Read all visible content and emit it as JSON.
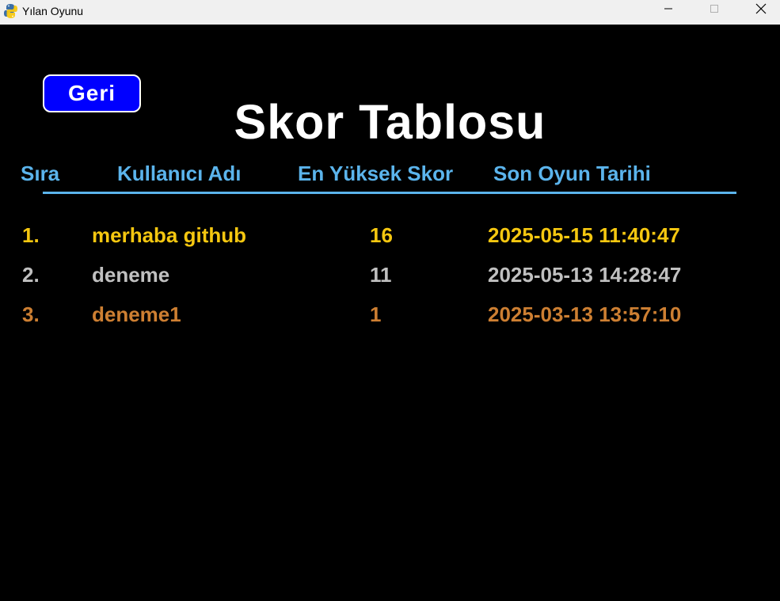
{
  "window": {
    "title": "Yılan Oyunu",
    "app_icon": "python-icon"
  },
  "colors": {
    "background": "#000000",
    "header": "#5bb4ec",
    "rank1": "#f5c710",
    "rank2": "#c0c0c0",
    "rank3": "#cd7f32",
    "back_button": "#0000ff"
  },
  "back_button": {
    "label": "Geri"
  },
  "title": "Skor Tablosu",
  "columns": {
    "rank": "Sıra",
    "username": "Kullanıcı Adı",
    "high_score": "En Yüksek Skor",
    "last_game_date": "Son Oyun Tarihi"
  },
  "rows": [
    {
      "rank": "1.",
      "username": "merhaba github",
      "score": "16",
      "date": "2025-05-15 11:40:47"
    },
    {
      "rank": "2.",
      "username": "deneme",
      "score": "11",
      "date": "2025-05-13 14:28:47"
    },
    {
      "rank": "3.",
      "username": "deneme1",
      "score": "1",
      "date": "2025-03-13 13:57:10"
    }
  ]
}
